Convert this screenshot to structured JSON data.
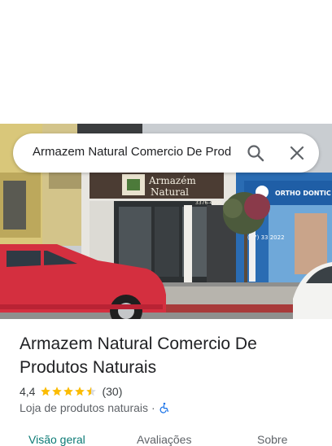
{
  "search": {
    "query": "Armazem Natural Comercio De Prod"
  },
  "photo": {
    "sign_line1": "Armazém",
    "sign_line2": "Natural",
    "sign_phone": "3376-4999",
    "neighbor_sign": "ORTHO DONTIC",
    "neighbor_phone": "(47) 33  2022"
  },
  "place": {
    "title": "Armazem Natural Comercio De Produtos Naturais",
    "rating": "4,4",
    "rating_value": 4.4,
    "reviews": "(30)",
    "category": "Loja de produtos naturais",
    "separator": "·",
    "accessibility_icon": "wheelchair-icon"
  },
  "tabs": [
    {
      "label": "Visão geral",
      "active": true
    },
    {
      "label": "Avaliações",
      "active": false
    },
    {
      "label": "Sobre",
      "active": false
    }
  ],
  "colors": {
    "accent": "#0b7a75",
    "star": "#fbbc04",
    "access": "#1a73e8",
    "car": "#d42f3f"
  }
}
